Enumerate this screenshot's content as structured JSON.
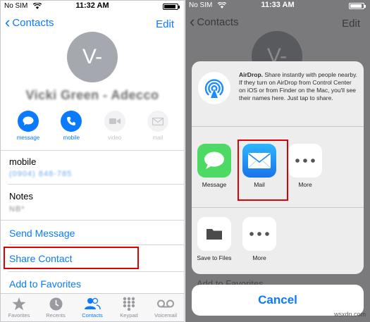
{
  "left": {
    "status": {
      "carrier": "No SIM",
      "time": "11:32 AM",
      "battery_level": 0.9
    },
    "nav": {
      "back_label": "Contacts",
      "edit_label": "Edit"
    },
    "avatar_initials": "V-",
    "contact_name": "Vicki Green - Adecco",
    "actions": [
      {
        "label": "message",
        "icon": "message-bubble-icon",
        "enabled": true
      },
      {
        "label": "mobile",
        "icon": "phone-icon",
        "enabled": true
      },
      {
        "label": "video",
        "icon": "video-camera-icon",
        "enabled": false
      },
      {
        "label": "mail",
        "icon": "envelope-icon",
        "enabled": false
      }
    ],
    "mobile_label": "mobile",
    "mobile_value": "(0904) 848-785",
    "notes_label": "Notes",
    "notes_value": "NB*",
    "send_message": "Send Message",
    "share_contact": "Share Contact",
    "add_to_favorites": "Add to Favorites",
    "tabs": [
      {
        "label": "Favorites",
        "icon": "star-icon",
        "active": false
      },
      {
        "label": "Recents",
        "icon": "clock-icon",
        "active": false
      },
      {
        "label": "Contacts",
        "icon": "people-icon",
        "active": true
      },
      {
        "label": "Keypad",
        "icon": "keypad-icon",
        "active": false
      },
      {
        "label": "Voicemail",
        "icon": "voicemail-icon",
        "active": false
      }
    ]
  },
  "right": {
    "status": {
      "carrier": "No SIM",
      "time": "11:33 AM",
      "battery_level": 0.9
    },
    "nav": {
      "back_label": "Contacts",
      "edit_label": "Edit"
    },
    "avatar_initials": "V-",
    "background_row": "Add to Favorites",
    "airdrop": {
      "title": "AirDrop.",
      "description": "Share instantly with people nearby. If they turn on AirDrop from Control Center on iOS or from Finder on the Mac, you'll see their names here. Just tap to share."
    },
    "share_apps": [
      {
        "label": "Message",
        "icon": "messages-app-icon"
      },
      {
        "label": "Mail",
        "icon": "mail-app-icon"
      },
      {
        "label": "More",
        "icon": "more-dots-icon"
      }
    ],
    "share_actions": [
      {
        "label": "Save to Files",
        "icon": "folder-icon"
      },
      {
        "label": "More",
        "icon": "more-dots-icon"
      }
    ],
    "cancel_label": "Cancel"
  },
  "colors": {
    "ios_blue": "#0a7aff",
    "highlight_red": "#e00000",
    "messages_green": "#4cd964"
  },
  "watermark": "wsxdn.com"
}
